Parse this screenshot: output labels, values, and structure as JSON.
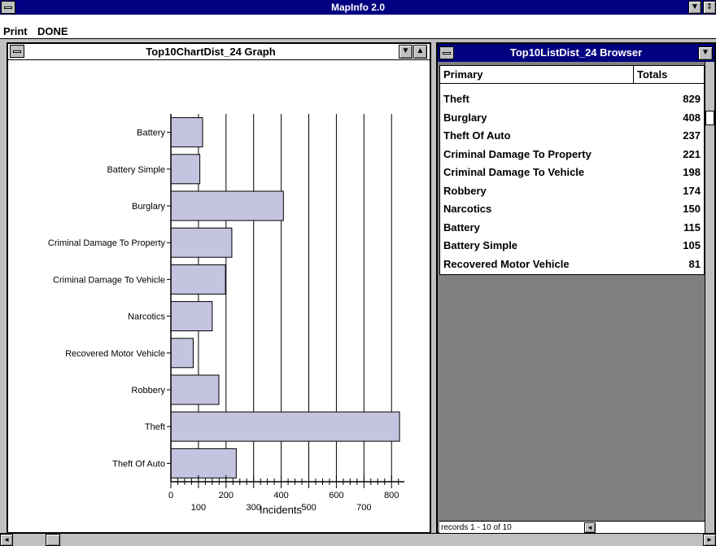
{
  "app": {
    "title": "MapInfo 2.0"
  },
  "menu": {
    "items": [
      "Print",
      "DONE"
    ]
  },
  "graph_window": {
    "title": "Top10ChartDist_24 Graph"
  },
  "browser_window": {
    "title": "Top10ListDist_24 Browser",
    "columns": [
      "Primary",
      "Totals"
    ],
    "rows": [
      {
        "primary": "Theft",
        "total": "829"
      },
      {
        "primary": "Burglary",
        "total": "408"
      },
      {
        "primary": "Theft Of Auto",
        "total": "237"
      },
      {
        "primary": "Criminal Damage To Property",
        "total": "221"
      },
      {
        "primary": "Criminal Damage To Vehicle",
        "total": "198"
      },
      {
        "primary": "Robbery",
        "total": "174"
      },
      {
        "primary": "Narcotics",
        "total": "150"
      },
      {
        "primary": "Battery",
        "total": "115"
      },
      {
        "primary": "Battery Simple",
        "total": "105"
      },
      {
        "primary": "Recovered Motor Vehicle",
        "total": "81"
      }
    ],
    "status": "records 1 - 10 of 10"
  },
  "chart_data": {
    "type": "bar",
    "orientation": "horizontal",
    "categories": [
      "Battery",
      "Battery Simple",
      "Burglary",
      "Criminal Damage To Property",
      "Criminal Damage To Vehicle",
      "Narcotics",
      "Recovered Motor Vehicle",
      "Robbery",
      "Theft",
      "Theft Of Auto"
    ],
    "values": [
      115,
      105,
      408,
      221,
      198,
      150,
      81,
      174,
      829,
      237
    ],
    "xlabel": "Incidents",
    "xlim": [
      0,
      850
    ],
    "ticks_lower": [
      "0",
      "200",
      "400",
      "600",
      "800"
    ],
    "ticks_upper": [
      "100",
      "300",
      "500",
      "700"
    ],
    "bar_color": "#c4c4e0",
    "grid": true
  },
  "colors": {
    "titlebar": "#000080",
    "window_bg": "#c0c0c0",
    "browser_bg": "#808080"
  }
}
